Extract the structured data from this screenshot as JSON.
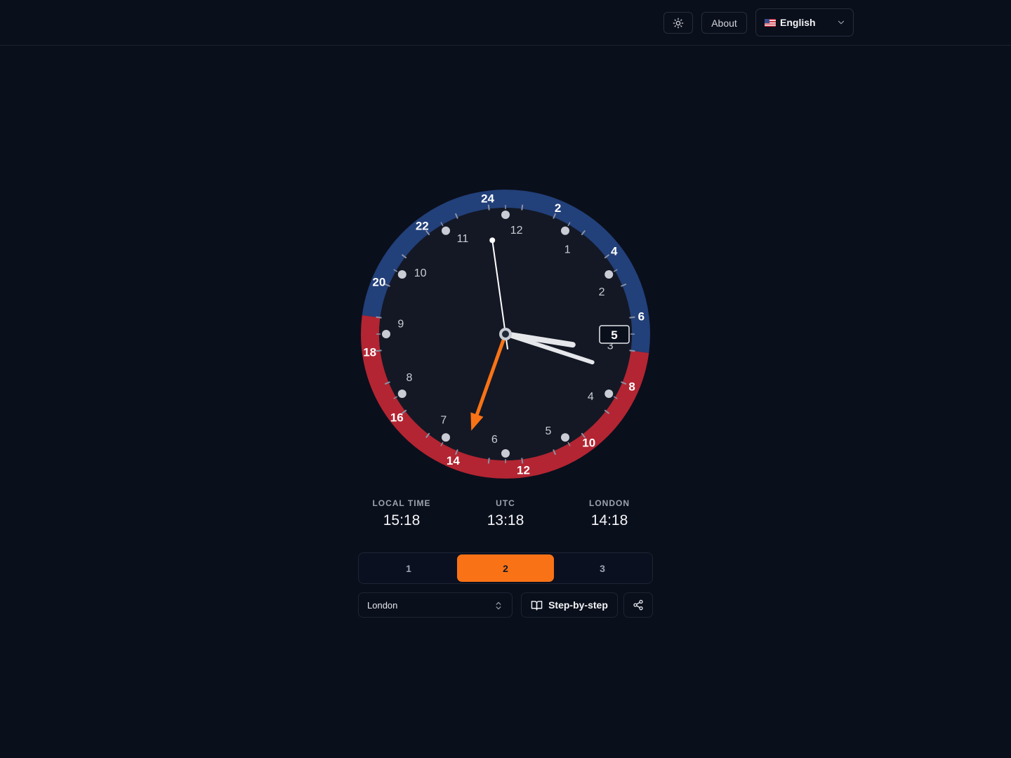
{
  "header": {
    "theme_icon": "sun-icon",
    "about_label": "About",
    "language": {
      "selected": "English",
      "flag_icon": "us-flag-icon",
      "chevron_icon": "chevron-down-icon"
    }
  },
  "clock": {
    "outer_ring_labels": [
      "24",
      "2",
      "4",
      "6",
      "8",
      "10",
      "12",
      "14",
      "16",
      "18",
      "20",
      "22"
    ],
    "inner_labels": [
      "12",
      "1",
      "2",
      "3",
      "4",
      "5",
      "6",
      "7",
      "8",
      "9",
      "10",
      "11"
    ],
    "date_window": "5",
    "night_color": "#22407a",
    "day_color": "#b32532",
    "gmt_hand_color": "#f97316",
    "time": {
      "hours": 15,
      "minutes": 18
    },
    "gmt_hour": 13.3
  },
  "timezones": [
    {
      "label": "LOCAL TIME",
      "time": "15:18"
    },
    {
      "label": "UTC",
      "time": "13:18"
    },
    {
      "label": "LONDON",
      "time": "14:18"
    }
  ],
  "segmented": {
    "options": [
      "1",
      "2",
      "3"
    ],
    "selected": "2"
  },
  "controls": {
    "city": "London",
    "step_label": "Step-by-step",
    "step_icon": "book-open-icon",
    "share_icon": "share-icon",
    "select_icon": "chevron-up-down-icon"
  },
  "colors": {
    "accent": "#f97316",
    "background": "#0a0f1c"
  }
}
